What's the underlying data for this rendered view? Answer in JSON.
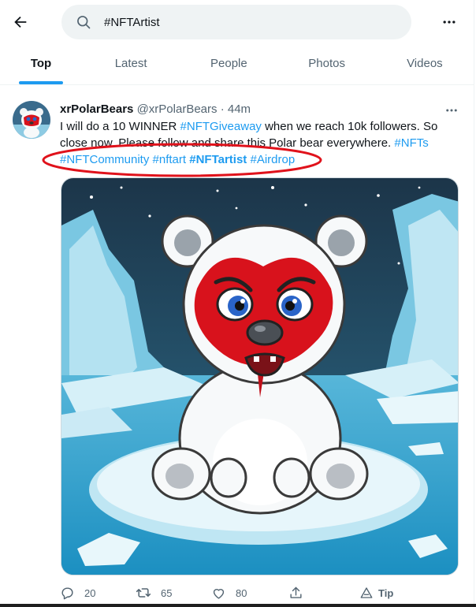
{
  "header": {
    "back_icon": "arrow-left-icon",
    "search_value": "#NFTArtist",
    "search_icon": "search-icon",
    "more_icon": "more-horizontal-icon"
  },
  "tabs": [
    {
      "label": "Top",
      "active": true
    },
    {
      "label": "Latest",
      "active": false
    },
    {
      "label": "People",
      "active": false
    },
    {
      "label": "Photos",
      "active": false
    },
    {
      "label": "Videos",
      "active": false
    }
  ],
  "tweet": {
    "display_name": "xrPolarBears",
    "handle": "@xrPolarBears",
    "separator": "·",
    "time": "44m",
    "text_parts": {
      "p1": "I will do a 10 WINNER ",
      "h1": "#NFTGiveaway",
      "p2": " when we reach 10k followers. So close now. Please follow and share this Polar bear everywhere. ",
      "h2": "#NFTs",
      "sp1": " ",
      "h3": "#NFTCommunity",
      "sp2": " ",
      "h4": "#nftart",
      "sp3": " ",
      "h5": "#NFTartist",
      "sp4": " ",
      "h6": "#Airdrop"
    },
    "annotation_color": "#e0121b",
    "actions": {
      "reply_count": "20",
      "retweet_count": "65",
      "like_count": "80",
      "tip_label": "Tip"
    }
  },
  "colors": {
    "accent": "#1d9bf0",
    "text": "#0f1419",
    "muted": "#536471"
  }
}
